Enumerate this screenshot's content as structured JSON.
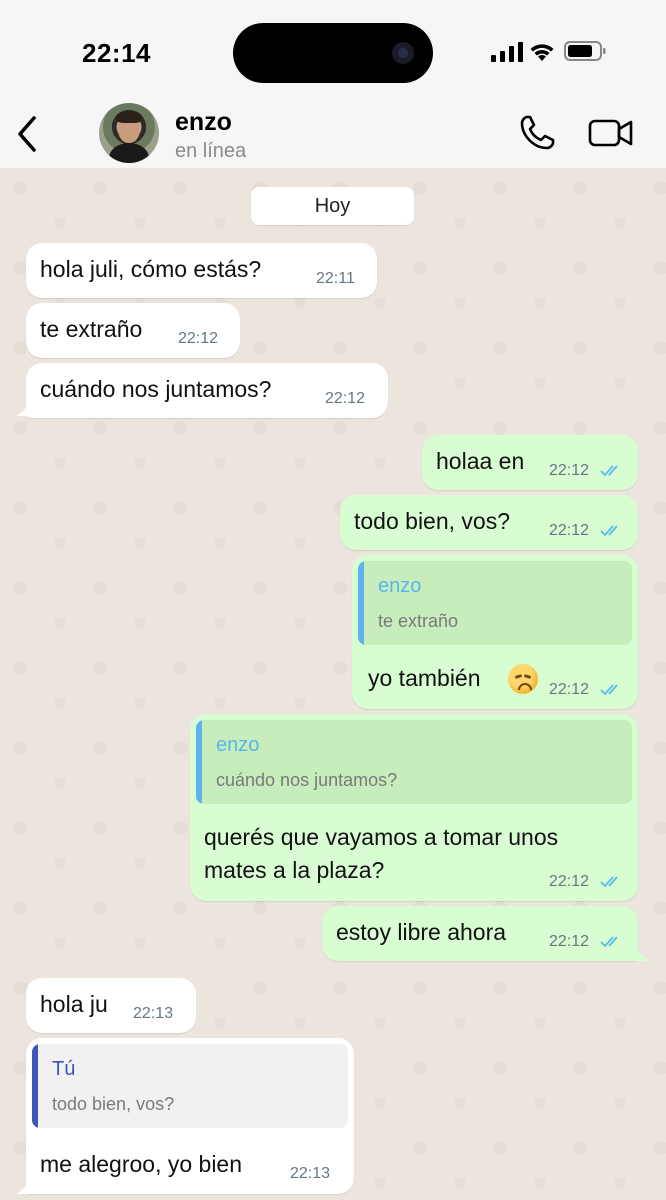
{
  "status_bar": {
    "time": "22:14"
  },
  "header": {
    "name": "enzo",
    "status": "en línea"
  },
  "chat": {
    "day_label": "Hoy",
    "messages": [
      {
        "dir": "in",
        "text": "hola juli, cómo estás?",
        "time": "22:11"
      },
      {
        "dir": "in",
        "text": "te extraño",
        "time": "22:12"
      },
      {
        "dir": "in",
        "text": "cuándo nos juntamos?",
        "time": "22:12"
      },
      {
        "dir": "out",
        "text": "holaa en",
        "time": "22:12",
        "read": true
      },
      {
        "dir": "out",
        "text": "todo bien, vos?",
        "time": "22:12",
        "read": true
      },
      {
        "dir": "out",
        "quote_author": "enzo",
        "quote_text": "te extraño",
        "text": "yo también",
        "emoji": "disappointed-face",
        "time": "22:12",
        "read": true
      },
      {
        "dir": "out",
        "quote_author": "enzo",
        "quote_text": "cuándo nos juntamos?",
        "text_line1": "querés que vayamos a tomar unos",
        "text_line2": "mates a la plaza?",
        "time": "22:12",
        "read": true
      },
      {
        "dir": "out",
        "text": "estoy libre ahora",
        "time": "22:12",
        "read": true
      },
      {
        "dir": "in",
        "text": "hola ju",
        "time": "22:13"
      },
      {
        "dir": "in",
        "quote_author": "Tú",
        "quote_text": "todo bien, vos?",
        "text": "me alegroo, yo bien",
        "time": "22:13"
      }
    ]
  },
  "colors": {
    "chat_background": "#ece5dd",
    "outgoing_bubble": "#d9fdd3",
    "incoming_bubble": "#ffffff",
    "read_ticks": "#53bdeb",
    "quote_enzo_accent": "#5bb5ec",
    "quote_you_accent": "#3d56b8"
  }
}
